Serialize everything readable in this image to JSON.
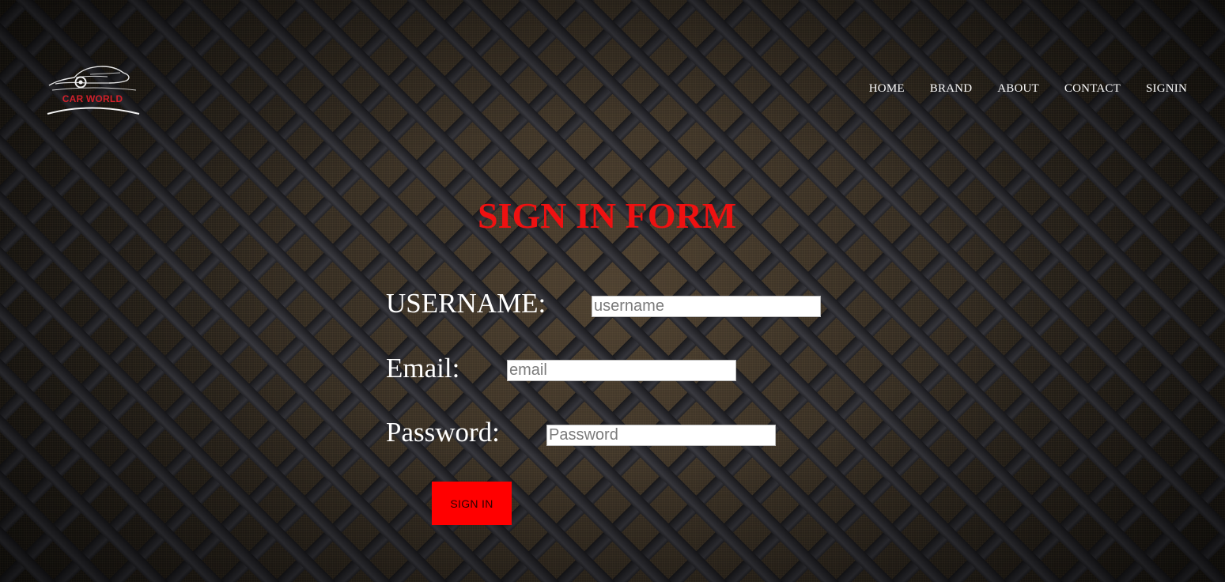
{
  "brand": {
    "logo_text": "CAR WORLD",
    "accent_color": "#d1202a"
  },
  "nav": {
    "items": [
      {
        "label": "HOME"
      },
      {
        "label": "BRAND"
      },
      {
        "label": "ABOUT"
      },
      {
        "label": "CONTACT"
      },
      {
        "label": "SIGNIN"
      }
    ]
  },
  "form": {
    "title": "SIGN IN FORM",
    "title_color": "#ee1111",
    "username": {
      "label": "USERNAME:",
      "placeholder": "username",
      "value": ""
    },
    "email": {
      "label": "Email:",
      "placeholder": "email",
      "value": ""
    },
    "password": {
      "label": "Password:",
      "placeholder": "Password",
      "value": ""
    },
    "submit_label": "SIGN IN",
    "submit_color": "#ff0000"
  },
  "icons": {
    "logo": "car-silhouette-icon"
  }
}
